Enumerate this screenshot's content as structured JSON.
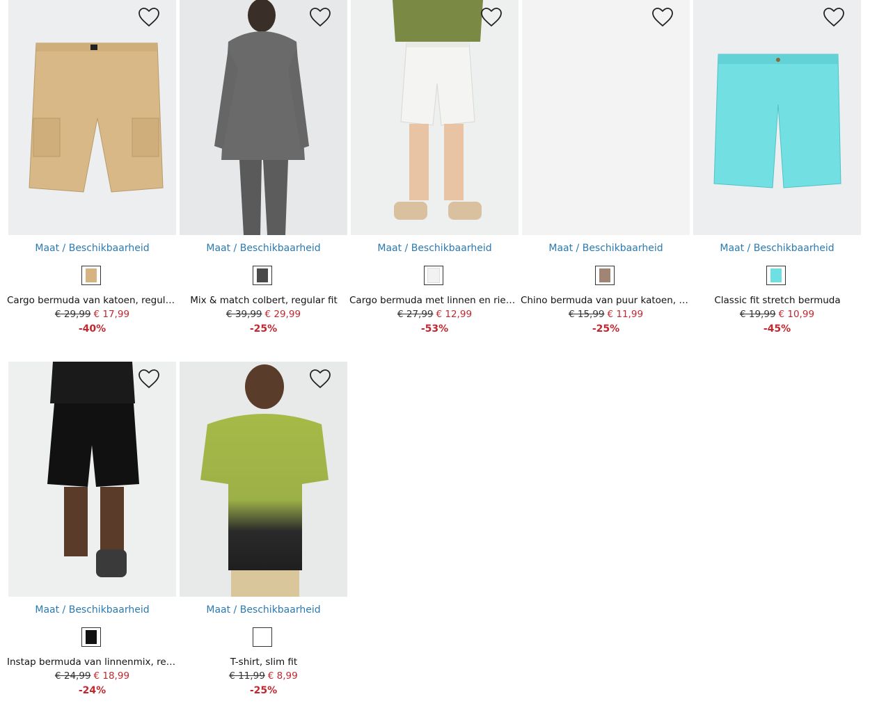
{
  "products": [
    {
      "title": "Cargo bermuda van katoen, regular fit",
      "size_link": "Maat / Beschikbaarheid",
      "old_price": "€ 29,99",
      "new_price": "€ 17,99",
      "discount": "-40%",
      "swatch_color": "#d6b482",
      "image": "beige-cargo-shorts",
      "favorite_icon": "heart-outline-icon"
    },
    {
      "title": "Mix & match colbert, regular fit",
      "size_link": "Maat / Beschikbaarheid",
      "old_price": "€ 39,99",
      "new_price": "€ 29,99",
      "discount": "-25%",
      "swatch_color": "#4a4a4a",
      "image": "grey-blazer-model",
      "favorite_icon": "heart-outline-icon"
    },
    {
      "title": "Cargo bermuda met linnen en riem, regular fit",
      "size_link": "Maat / Beschikbaarheid",
      "old_price": "€ 27,99",
      "new_price": "€ 12,99",
      "discount": "-53%",
      "swatch_color": "#f2f2f2",
      "image": "white-shorts-model",
      "favorite_icon": "heart-outline-icon"
    },
    {
      "title": "Chino bermuda van puur katoen, regular fit",
      "size_link": "Maat / Beschikbaarheid",
      "old_price": "€ 15,99",
      "new_price": "€ 11,99",
      "discount": "-25%",
      "swatch_color": "#a08672",
      "image": "blank-placeholder",
      "favorite_icon": "heart-outline-icon"
    },
    {
      "title": "Classic fit stretch bermuda",
      "size_link": "Maat / Beschikbaarheid",
      "old_price": "€ 19,99",
      "new_price": "€ 10,99",
      "discount": "-45%",
      "swatch_color": "#6ee0e4",
      "image": "turquoise-shorts",
      "favorite_icon": "heart-outline-icon"
    },
    {
      "title": "Instap bermuda van linnenmix, regular fit",
      "size_link": "Maat / Beschikbaarheid",
      "old_price": "€ 24,99",
      "new_price": "€ 18,99",
      "discount": "-24%",
      "swatch_color": "#111111",
      "image": "black-shorts-model",
      "favorite_icon": "heart-outline-icon"
    },
    {
      "title": "T-shirt, slim fit",
      "size_link": "Maat / Beschikbaarheid",
      "old_price": "€ 11,99",
      "new_price": "€ 8,99",
      "discount": "-25%",
      "swatch_color": "#ffffff",
      "image": "green-tshirt-model",
      "favorite_icon": "heart-outline-icon"
    }
  ],
  "colors": {
    "link": "#2a7ab0",
    "sale": "#c0282f",
    "image_bg": "#eceeef"
  }
}
